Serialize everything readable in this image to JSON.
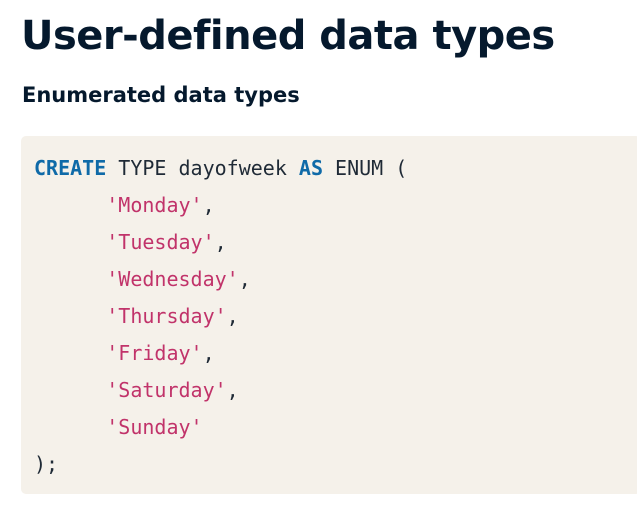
{
  "page": {
    "title": "User-defined data types",
    "subtitle": "Enumerated data types"
  },
  "code": {
    "line1": {
      "kw_create": "CREATE",
      "type_name": " TYPE dayofweek ",
      "kw_as": "AS",
      "enum_open": " ENUM ("
    },
    "indent": "      ",
    "values": [
      {
        "text": "'Monday'",
        "suffix": ","
      },
      {
        "text": "'Tuesday'",
        "suffix": ","
      },
      {
        "text": "'Wednesday'",
        "suffix": ","
      },
      {
        "text": "'Thursday'",
        "suffix": ","
      },
      {
        "text": "'Friday'",
        "suffix": ","
      },
      {
        "text": "'Saturday'",
        "suffix": ","
      },
      {
        "text": "'Sunday'",
        "suffix": ""
      }
    ],
    "closing": ");"
  },
  "colors": {
    "keyword": "#0f6aa8",
    "string": "#c1336a",
    "code_background": "#f5f1ea",
    "heading": "#05192d"
  }
}
